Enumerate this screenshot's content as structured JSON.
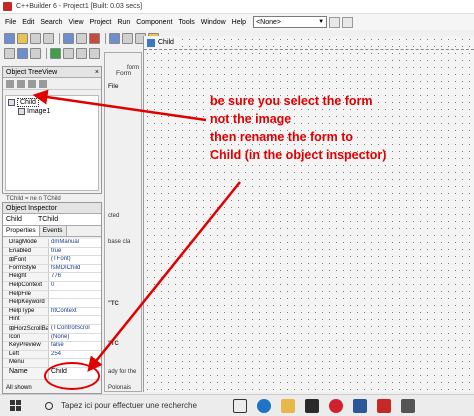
{
  "window": {
    "title": "C++Builder 6 - Project1 [Built: 0.03 secs]"
  },
  "menu": {
    "items": [
      "File",
      "Edit",
      "Search",
      "View",
      "Project",
      "Run",
      "Component",
      "Tools",
      "Window",
      "Help"
    ],
    "combo_value": "<None>"
  },
  "treeview": {
    "title": "Object TreeView",
    "close": "×",
    "nodes": {
      "child": "Child",
      "image": "Image1"
    }
  },
  "midtext": "TChild = ne n TChild",
  "inspector": {
    "title": "Object Inspector",
    "selected_name": "Child",
    "selected_type": "TChild",
    "tabs": [
      "Properties",
      "Events"
    ],
    "properties": [
      {
        "name": "DragMode",
        "value": "dmManual"
      },
      {
        "name": "Enabled",
        "value": "true"
      },
      {
        "name": "⊞Font",
        "value": "(TFont)"
      },
      {
        "name": "FormStyle",
        "value": "fsMDIChild"
      },
      {
        "name": "Height",
        "value": "776"
      },
      {
        "name": "HelpContext",
        "value": "0"
      },
      {
        "name": "HelpFile",
        "value": ""
      },
      {
        "name": "HelpKeyword",
        "value": ""
      },
      {
        "name": "HelpType",
        "value": "htContext"
      },
      {
        "name": "Hint",
        "value": ""
      },
      {
        "name": "⊞HorzScrollBar",
        "value": "(TControlScrol"
      },
      {
        "name": "Icon",
        "value": "(None)"
      },
      {
        "name": "KeyPreview",
        "value": "false"
      },
      {
        "name": "Left",
        "value": "254"
      },
      {
        "name": "Menu",
        "value": ""
      }
    ],
    "name_prop": {
      "name": "Name",
      "value": "Child"
    },
    "status": "All shown"
  },
  "background_form": {
    "title": "Form",
    "menu_label": "File",
    "texts": [
      "form",
      "cted",
      "base cla",
      "\"TC",
      "\"TC",
      "ady for the",
      "Polonais"
    ]
  },
  "designer": {
    "title": "Child"
  },
  "annotation": {
    "lines": [
      "be sure you select the form",
      "not the image",
      "then rename the form to",
      "Child (in the object inspector)"
    ],
    "color": "#e00000"
  },
  "taskbar": {
    "search_placeholder": "Tapez ici pour effectuer une recherche"
  }
}
